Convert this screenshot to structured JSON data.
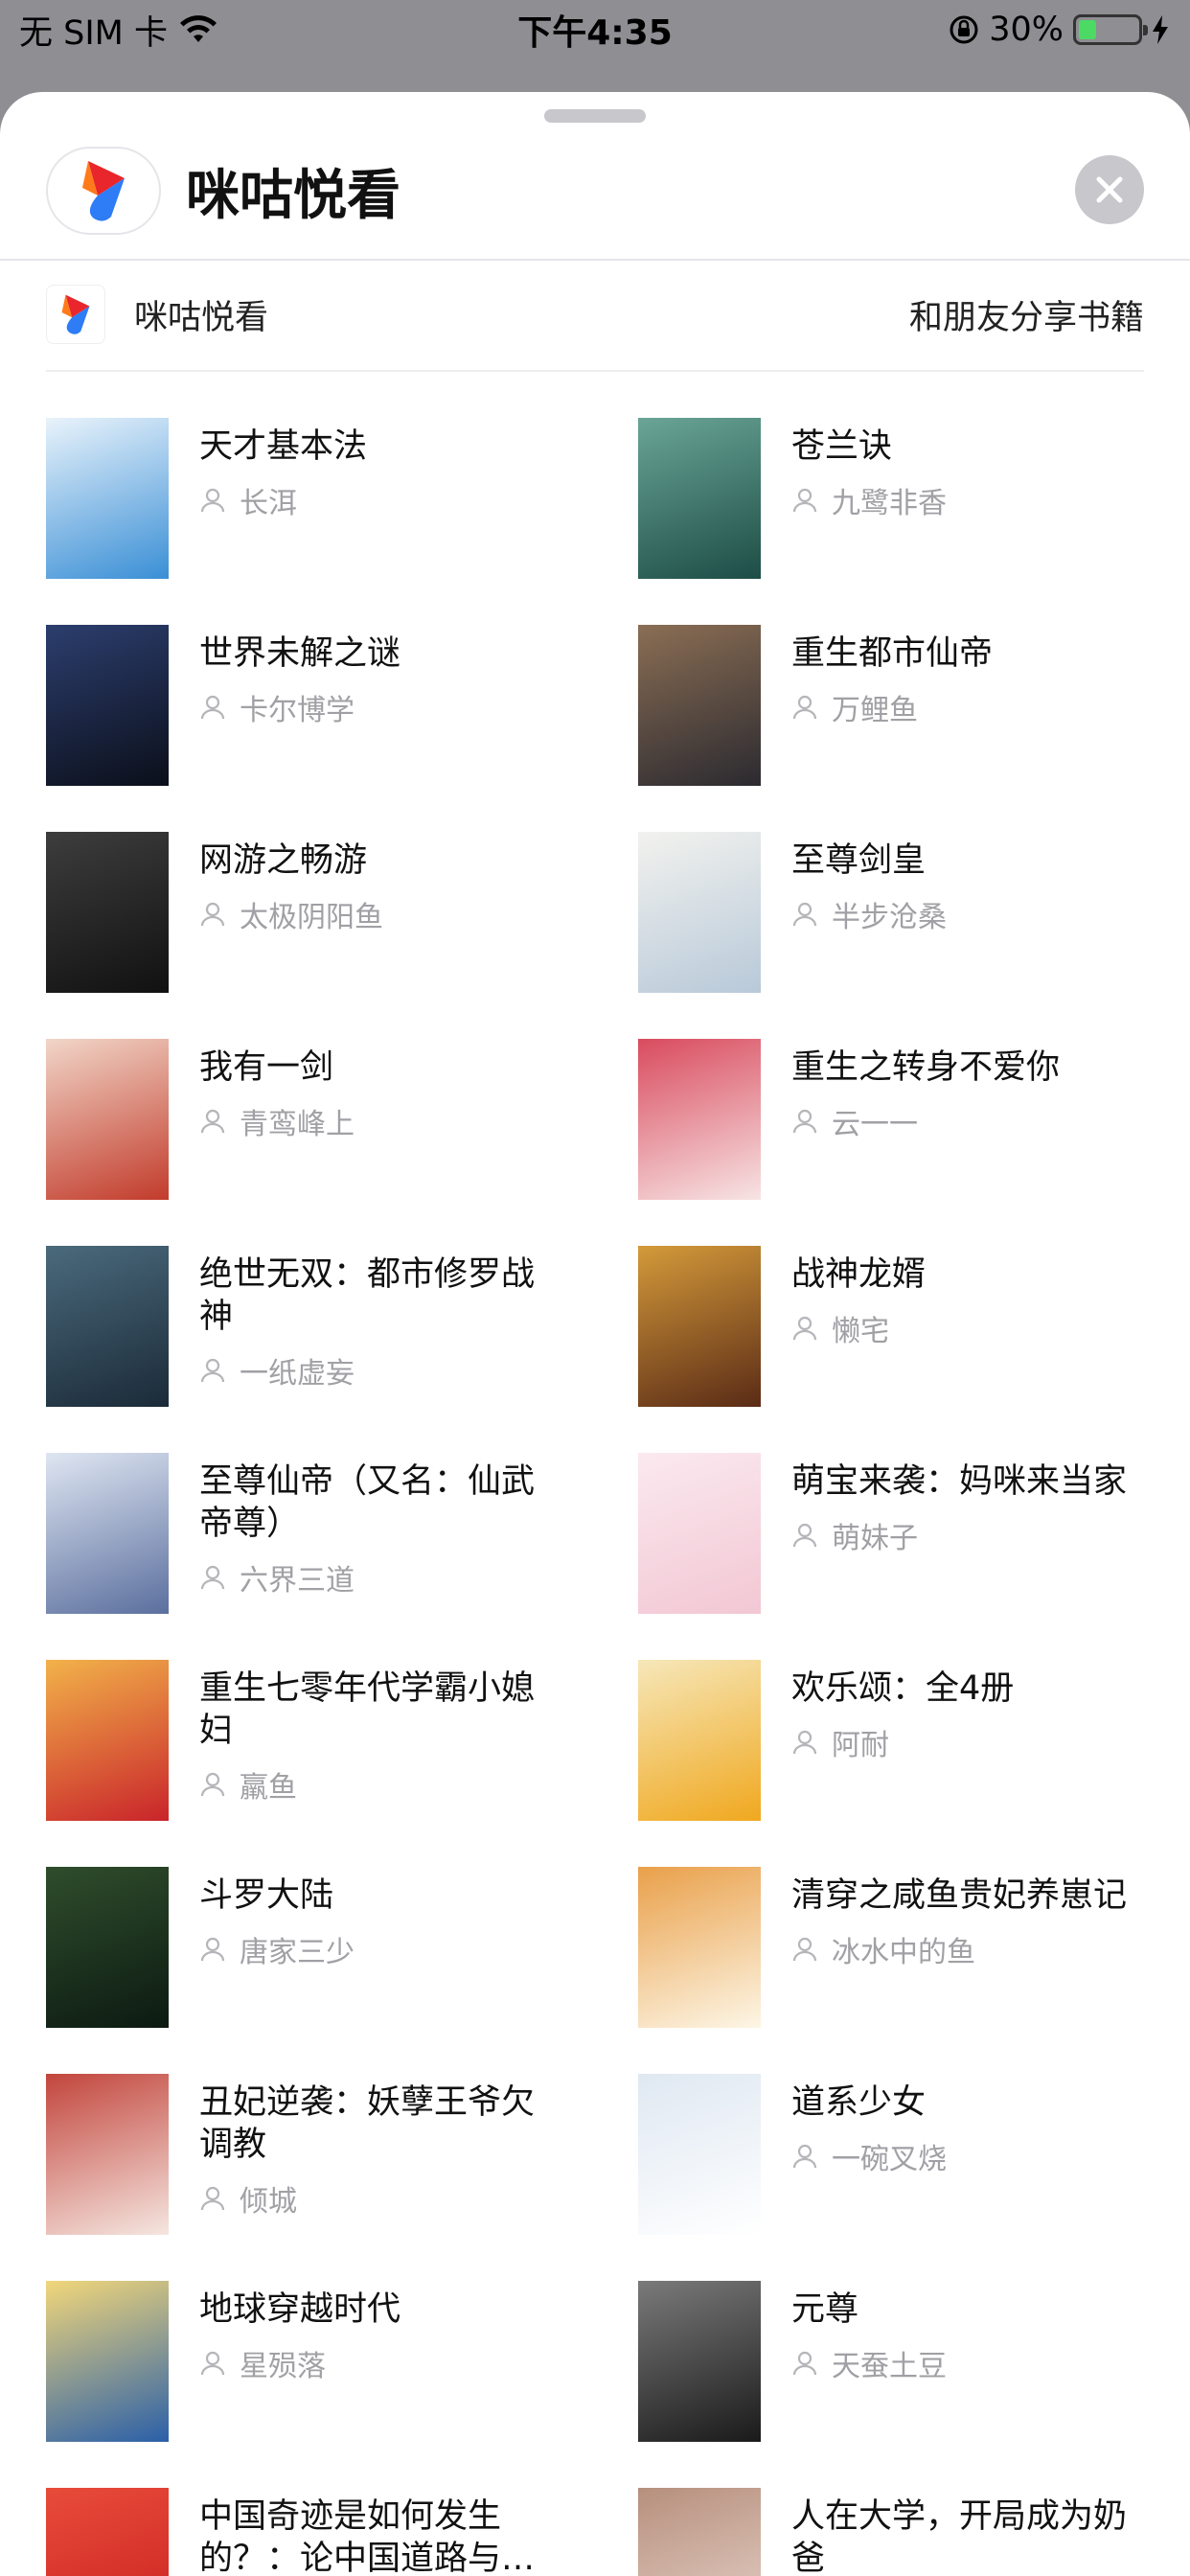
{
  "status_bar": {
    "carrier": "无 SIM 卡",
    "time": "下午4:35",
    "battery": "30%",
    "battery_level": 0.3
  },
  "sheet": {
    "title": "咪咕悦看",
    "source_name": "咪咕悦看",
    "share_text": "和朋友分享书籍"
  },
  "colors": {
    "accent_blue": "#2e7cf6",
    "accent_orange": "#ff6a1a",
    "accent_red": "#e8262b",
    "battery_green": "#4cd964"
  },
  "books": [
    {
      "title": "天才基本法",
      "author": "长洱",
      "cover": [
        "#3a8fd6",
        "#e9f3fb"
      ]
    },
    {
      "title": "苍兰诀",
      "author": "九鹭非香",
      "cover": [
        "#1d4d46",
        "#6aa597"
      ]
    },
    {
      "title": "世界未解之谜",
      "author": "卡尔博学",
      "cover": [
        "#0b0f1a",
        "#2c3e6e"
      ]
    },
    {
      "title": "重生都市仙帝",
      "author": "万鲤鱼",
      "cover": [
        "#2b2a30",
        "#8b6e54"
      ]
    },
    {
      "title": "网游之畅游",
      "author": "太极阴阳鱼",
      "cover": [
        "#111111",
        "#3d3d3d"
      ]
    },
    {
      "title": "至尊剑皇",
      "author": "半步沧桑",
      "cover": [
        "#b8c9d9",
        "#f2f2ee"
      ]
    },
    {
      "title": "我有一剑",
      "author": "青鸾峰上",
      "cover": [
        "#c23b2b",
        "#f1d6c8"
      ]
    },
    {
      "title": "重生之转身不爱你",
      "author": "云一一",
      "cover": [
        "#f7e4e4",
        "#d94b5e"
      ]
    },
    {
      "title": "绝世无双：都市修罗战神",
      "author": "一纸虚妄",
      "cover": [
        "#1b2a38",
        "#4a6a7c"
      ]
    },
    {
      "title": "战神龙婿",
      "author": "懒宅",
      "cover": [
        "#5a2b16",
        "#d49a3a"
      ]
    },
    {
      "title": "至尊仙帝（又名：仙武帝尊）",
      "author": "六界三道",
      "cover": [
        "#5b6f9e",
        "#dfe6f2"
      ]
    },
    {
      "title": "萌宝来袭：妈咪来当家",
      "author": "萌妹子",
      "cover": [
        "#f2c7d4",
        "#fbe9ef"
      ]
    },
    {
      "title": "重生七零年代学霸小媳妇",
      "author": "羸鱼",
      "cover": [
        "#c9242a",
        "#f2b24a"
      ]
    },
    {
      "title": "欢乐颂：全4册",
      "author": "阿耐",
      "cover": [
        "#f0a81f",
        "#f6e7b9"
      ]
    },
    {
      "title": "斗罗大陆",
      "author": "唐家三少",
      "cover": [
        "#0c1a12",
        "#2f4d2c"
      ]
    },
    {
      "title": "清穿之咸鱼贵妃养崽记",
      "author": "冰水中的鱼",
      "cover": [
        "#fdf6e6",
        "#e9a04a"
      ]
    },
    {
      "title": "丑妃逆袭：妖孽王爷欠调教",
      "author": "倾城",
      "cover": [
        "#f5e6e0",
        "#c2453c"
      ]
    },
    {
      "title": "道系少女",
      "author": "一碗叉烧",
      "cover": [
        "#ffffff",
        "#dfe8f2"
      ]
    },
    {
      "title": "地球穿越时代",
      "author": "星殒落",
      "cover": [
        "#2a5fa8",
        "#f2d77a"
      ]
    },
    {
      "title": "元尊",
      "author": "天蚕土豆",
      "cover": [
        "#1a1a1a",
        "#7a7a7a"
      ]
    },
    {
      "title": "中国奇迹是如何发生的？：论中国道路与…",
      "author": "",
      "cover": [
        "#c8201f",
        "#e84b3a"
      ]
    },
    {
      "title": "人在大学，开局成为奶爸",
      "author": "",
      "cover": [
        "#e9d8cf",
        "#b78f7d"
      ]
    }
  ]
}
